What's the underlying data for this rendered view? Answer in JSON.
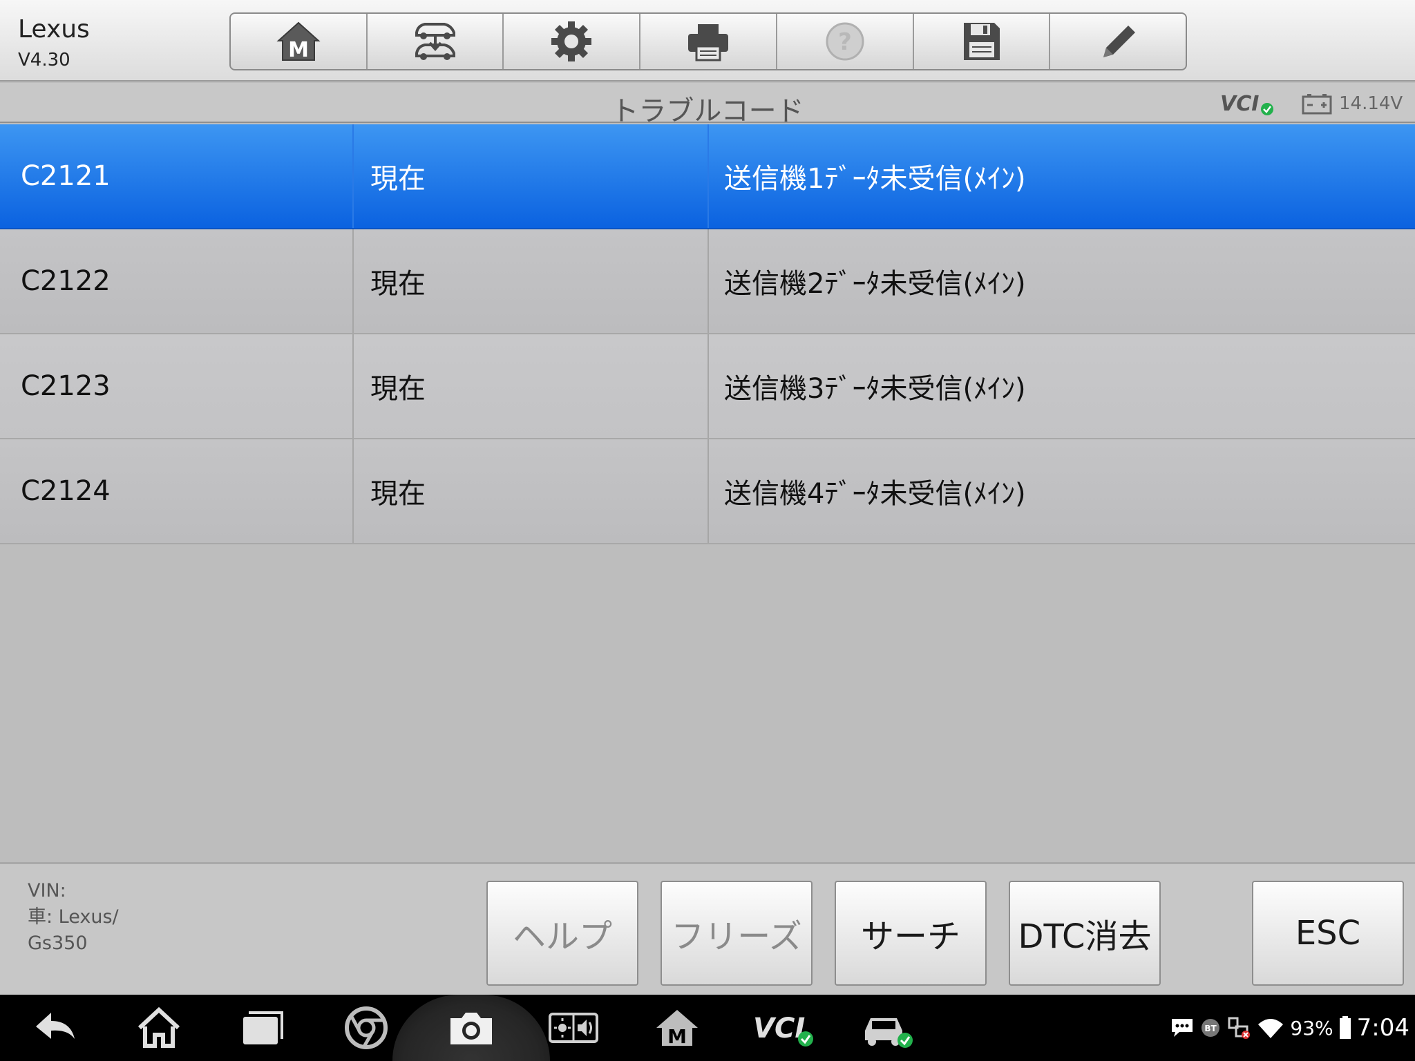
{
  "header": {
    "app_name": "Lexus",
    "version": "V4.30",
    "toolbar": [
      {
        "name": "home",
        "icon": "home-m-icon"
      },
      {
        "name": "vehicle-swap",
        "icon": "vehicle-swap-icon"
      },
      {
        "name": "settings",
        "icon": "gear-icon"
      },
      {
        "name": "print",
        "icon": "printer-icon"
      },
      {
        "name": "help",
        "icon": "help-icon"
      },
      {
        "name": "save",
        "icon": "floppy-disk-icon"
      },
      {
        "name": "edit",
        "icon": "pencil-icon"
      }
    ]
  },
  "titlebar": {
    "title": "トラブルコード",
    "vcl_label": "VCI",
    "battery_voltage": "14.14V"
  },
  "dtc_table": {
    "rows": [
      {
        "code": "C2121",
        "status": "現在",
        "description": "送信機1ﾃﾞｰﾀ未受信(ﾒｲﾝ)",
        "selected": true
      },
      {
        "code": "C2122",
        "status": "現在",
        "description": "送信機2ﾃﾞｰﾀ未受信(ﾒｲﾝ)",
        "selected": false
      },
      {
        "code": "C2123",
        "status": "現在",
        "description": "送信機3ﾃﾞｰﾀ未受信(ﾒｲﾝ)",
        "selected": false
      },
      {
        "code": "C2124",
        "status": "現在",
        "description": "送信機4ﾃﾞｰﾀ未受信(ﾒｲﾝ)",
        "selected": false
      }
    ]
  },
  "bottom_panel": {
    "vin_label": "VIN:",
    "vehicle_line1": "車: Lexus/",
    "vehicle_line2": "Gs350",
    "buttons": {
      "help": "ヘルプ",
      "freeze": "フリーズ",
      "search": "サーチ",
      "clear_dtc": "DTC消去",
      "esc": "ESC"
    }
  },
  "navbar": {
    "battery_percent": "93%",
    "time": "7:04",
    "bt_label": "BT",
    "vci_label": "VCI"
  },
  "colors": {
    "selected_row": "#1a73e8",
    "header_bg": "#e8e8e8",
    "table_bg": "#c0c0c2",
    "status_ok": "#22b14c"
  }
}
